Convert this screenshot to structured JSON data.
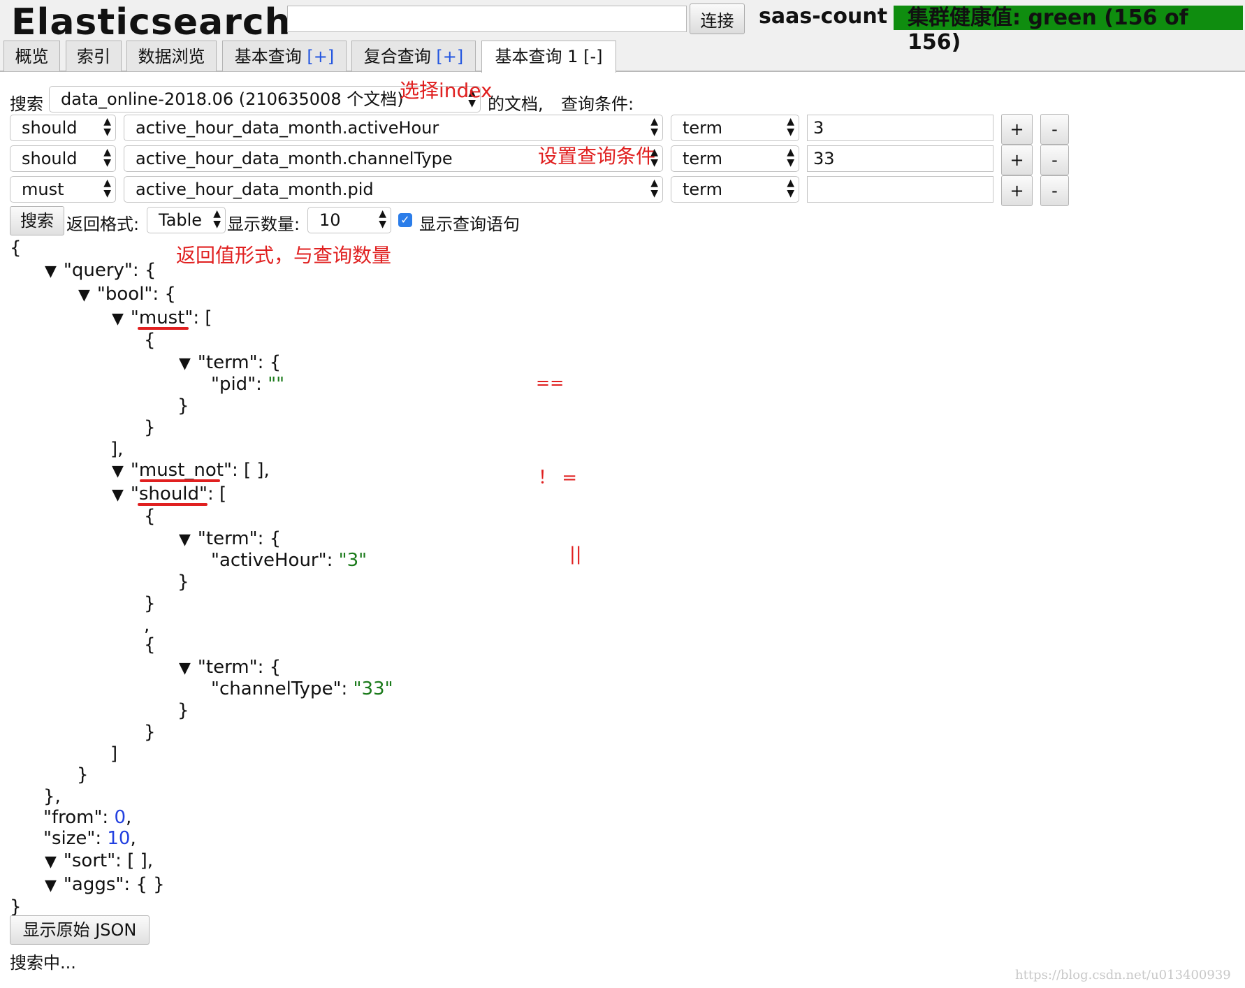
{
  "header": {
    "title": "Elasticsearch",
    "connection_value": "",
    "connect_label": "连接",
    "cluster_name": "saas-count",
    "health": "集群健康值: green (156 of 156)"
  },
  "tabs": [
    {
      "label": "概览"
    },
    {
      "label": "索引"
    },
    {
      "label": "数据浏览"
    },
    {
      "label": "基本查询",
      "control": "[+]"
    },
    {
      "label": "复合查询",
      "control": "[+]"
    },
    {
      "label": "基本查询 1",
      "control": "[-]"
    }
  ],
  "search_form": {
    "search_label": "搜索",
    "index_value": "data_online-2018.06 (210635008 个文档)",
    "docs_label": "的文档,",
    "query_cond_label": "查询条件:",
    "rows": [
      {
        "bool": "should",
        "field": "active_hour_data_month.activeHour",
        "op": "term",
        "value": "3"
      },
      {
        "bool": "should",
        "field": "active_hour_data_month.channelType",
        "op": "term",
        "value": "33"
      },
      {
        "bool": "must",
        "field": "active_hour_data_month.pid",
        "op": "term",
        "value": ""
      }
    ],
    "add_label": "+",
    "remove_label": "-",
    "search_button": "搜索",
    "format_label": "返回格式:",
    "format_value": "Table",
    "count_label": "显示数量:",
    "count_value": "10",
    "show_query_label": "显示查询语句",
    "show_query_checked": true
  },
  "annotations": {
    "select_index": "选择index",
    "set_query": "设置查询条件",
    "return_format": "返回值形式，与查询数量",
    "eq": "==",
    "neq": "！ =",
    "or": "||"
  },
  "json_tree": {
    "open_brace": "{",
    "query": "\"query\": {",
    "bool": "\"bool\": {",
    "must_key": "\"must\"",
    "must_rest": ": [",
    "must_obj_open": "{",
    "must_term": "\"term\": {",
    "pid_key": "\"pid\": ",
    "pid_val": "\"\"",
    "must_term_close": "}",
    "must_obj_close": "}",
    "must_close": "],",
    "must_not_key": "\"must_not\"",
    "must_not_rest": ": [ ],",
    "should_key": "\"should\"",
    "should_rest": ": [",
    "should_obj1_open": "{",
    "should_term1": "\"term\": {",
    "activeHour_key": "\"activeHour\": ",
    "activeHour_val": "\"3\"",
    "should_term1_close": "}",
    "should_obj1_close": "}",
    "comma": ",",
    "should_obj2_open": "{",
    "should_term2": "\"term\": {",
    "channelType_key": "\"channelType\": ",
    "channelType_val": "\"33\"",
    "should_term2_close": "}",
    "should_obj2_close": "}",
    "should_close": "]",
    "bool_close": "}",
    "query_close": "},",
    "from_key": "\"from\": ",
    "from_val": "0",
    "size_key": "\"size\": ",
    "size_val": "10",
    "sort": "\"sort\": [ ],",
    "aggs": "\"aggs\": { }",
    "close_brace": "}"
  },
  "footer": {
    "raw_json_button": "显示原始 JSON",
    "status": "搜索中...",
    "watermark": "https://blog.csdn.net/u013400939"
  }
}
